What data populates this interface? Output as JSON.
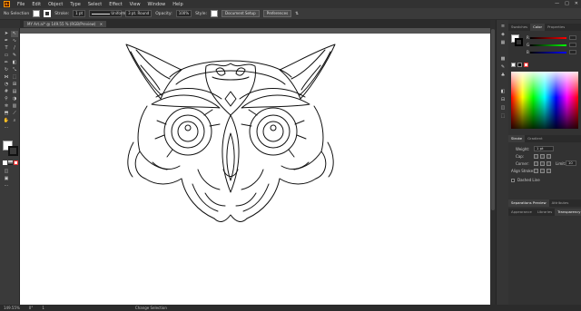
{
  "app": {
    "logo_text": "Ai"
  },
  "menu": [
    "File",
    "Edit",
    "Object",
    "Type",
    "Select",
    "Effect",
    "View",
    "Window",
    "Help"
  ],
  "window_controls": [
    "—",
    "□",
    "✕"
  ],
  "control_bar": {
    "selection_label": "No Selection",
    "stroke_label": "Stroke:",
    "stroke_value": "1 pt",
    "profile_label": "Uniform",
    "brush_label": "3 pt. Round",
    "opacity_label": "Opacity:",
    "opacity_value": "100%",
    "style_label": "Style:",
    "doc_setup_label": "Document Setup",
    "preferences_label": "Preferences"
  },
  "document_tab": {
    "label": "MY Art.ai* @ 149.55 % (RGB/Preview)",
    "close": "✕"
  },
  "status_bar": {
    "zoom": "149.55%",
    "rotation": "0°",
    "artboard": "1",
    "tool": "Change Selection"
  },
  "right_panel": {
    "top_tabs": [
      "Swatches",
      "Color",
      "Properties"
    ],
    "active_top_tab": "Color",
    "channels": [
      {
        "label": "R",
        "color": "#ff3b3b"
      },
      {
        "label": "G",
        "color": "#3bff3b"
      },
      {
        "label": "B",
        "color": "#3b6bff"
      }
    ],
    "stroke_tabs": [
      "Stroke",
      "Gradient"
    ],
    "weight_label": "Weight:",
    "weight_value": "1 pt",
    "cap_label": "Cap:",
    "corner_label": "Corner:",
    "limit_label": "Limit:",
    "limit_value": "10",
    "align_label": "Align Stroke:",
    "dashed_label": "Dashed Line",
    "mid_tabs": [
      "Separations Preview",
      "Attributes"
    ],
    "bottom_tabs": [
      "Appearance",
      "Libraries",
      "Transparency"
    ],
    "active_bottom_tab": "Transparency"
  },
  "tool_icons": [
    "selection-tool-icon",
    "direct-selection-tool-icon",
    "pen-tool-icon",
    "type-tool-icon",
    "line-tool-icon",
    "rectangle-tool-icon",
    "paintbrush-tool-icon",
    "pencil-tool-icon",
    "eraser-tool-icon",
    "rotate-tool-icon",
    "scale-tool-icon",
    "width-tool-icon",
    "shape-builder-tool-icon",
    "gradient-tool-icon",
    "eyedropper-tool-icon",
    "blend-tool-icon",
    "symbol-sprayer-tool-icon",
    "graph-tool-icon",
    "artboard-tool-icon",
    "hand-tool-icon",
    "zoom-tool-icon"
  ],
  "colors": {
    "accent": "#ff9a00",
    "panel_bg": "#323232",
    "canvas_bg": "#535353",
    "artboard": "#ffffff"
  }
}
